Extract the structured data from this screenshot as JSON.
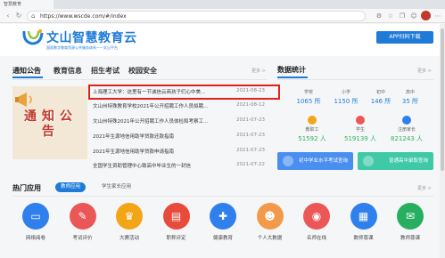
{
  "browser": {
    "tab_title": "智慧教育",
    "url": "https://www.wscde.com/#/index"
  },
  "header": {
    "logo_title": "文山智慧教育云",
    "logo_subtitle": "国家数字教育资源公共服务体系——文山平台",
    "app_button": "APP扫码下载"
  },
  "main_tabs": [
    {
      "label": "通知公告"
    },
    {
      "label": "教育信息"
    },
    {
      "label": "招生考试"
    },
    {
      "label": "校园安全"
    }
  ],
  "more_label": "更多 >",
  "notice_banner": {
    "text": "通知公告"
  },
  "news": [
    {
      "title": "上海理工大学：这里有一节诚信云商孩子们心中美…",
      "date": "2021-08-23"
    },
    {
      "title": "文山州特殊教育学校2021年公开招聘工作人员拟聘…",
      "date": "2021-08-12"
    },
    {
      "title": "文山州特殊2021年公开招聘工作人员体检和考察工…",
      "date": "2021-07-23"
    },
    {
      "title": "2021年生源地信用助学贷款还款指南",
      "date": "2021-07-23"
    },
    {
      "title": "2021年生源地信用助学贷款申请指南",
      "date": "2021-07-23"
    },
    {
      "title": "全国学生资助管理中心致高中毕业生的一封信",
      "date": "2021-07-22"
    }
  ],
  "stats": {
    "title": "数据统计",
    "items": [
      {
        "label": "学校",
        "value": "1065 所"
      },
      {
        "label": "小学",
        "value": "1150 所"
      },
      {
        "label": "初中",
        "value": "146 所"
      },
      {
        "label": "高中",
        "value": "35 所"
      },
      {
        "label": "教职工",
        "value": "51592 人"
      },
      {
        "label": "学生",
        "value": "519139 人"
      },
      {
        "label": "注册家长",
        "value": "821243 人"
      }
    ],
    "promos": [
      {
        "label": "初中学业水平考试查询"
      },
      {
        "label": "普通高中录取查询"
      }
    ]
  },
  "apps": {
    "title": "热门应用",
    "tabs": [
      {
        "label": "教师应用",
        "active": true
      },
      {
        "label": "学生家长应用",
        "active": false
      }
    ],
    "items": [
      {
        "label": "网络阅卷",
        "icon": "monitor-icon",
        "color": "#2f80ed"
      },
      {
        "label": "考试评价",
        "icon": "pencil-icon",
        "color": "#eb5757"
      },
      {
        "label": "大赛活动",
        "icon": "trophy-icon",
        "color": "#f2a516"
      },
      {
        "label": "职称评定",
        "icon": "certificate-icon",
        "color": "#e84a3b"
      },
      {
        "label": "健康教育",
        "icon": "medical-kit-icon",
        "color": "#2f80ed"
      },
      {
        "label": "个人大数据",
        "icon": "person-data-icon",
        "color": "#f2994a"
      },
      {
        "label": "名师在线",
        "icon": "teacher-online-icon",
        "color": "#eb5757"
      },
      {
        "label": "数师尊课",
        "icon": "book-grid-icon",
        "color": "#2f80ed"
      },
      {
        "label": "教师尊课",
        "icon": "chat-icon",
        "color": "#27ae60"
      }
    ]
  }
}
